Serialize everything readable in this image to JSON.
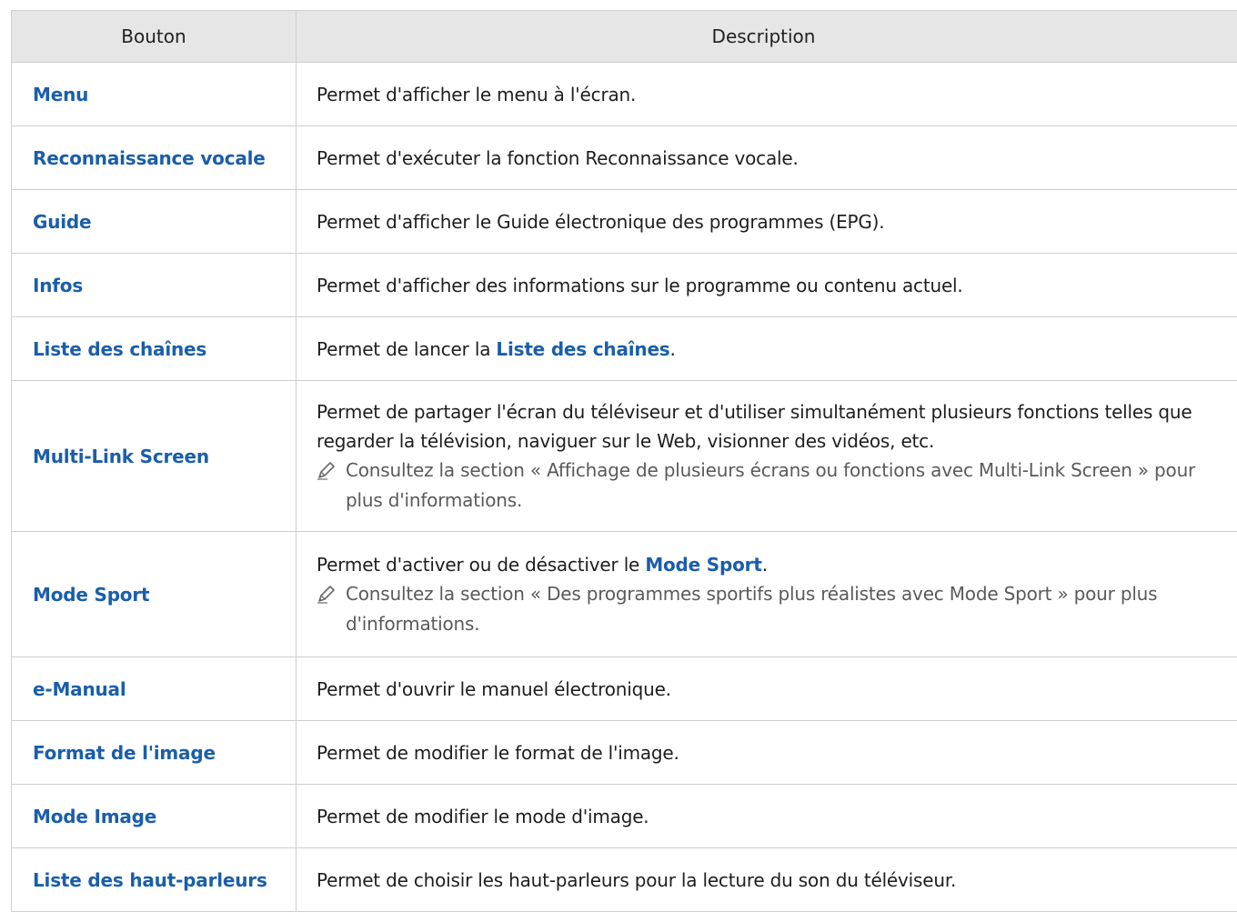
{
  "header": {
    "col1": "Bouton",
    "col2": "Description"
  },
  "rows": [
    {
      "button": "Menu",
      "desc": "Permet d'afficher le menu à l'écran."
    },
    {
      "button": "Reconnaissance vocale",
      "desc": "Permet d'exécuter la fonction Reconnaissance vocale."
    },
    {
      "button": "Guide",
      "desc": "Permet d'afficher le Guide électronique des programmes (EPG)."
    },
    {
      "button": "Infos",
      "desc": "Permet d'afficher des informations sur le programme ou contenu actuel."
    },
    {
      "button": "Liste des chaînes",
      "desc_pre": "Permet de lancer la ",
      "desc_link": "Liste des chaînes",
      "desc_post": "."
    },
    {
      "button": "Multi-Link Screen",
      "desc": "Permet de partager l'écran du téléviseur et d'utiliser simultanément plusieurs fonctions telles que regarder la télévision, naviguer sur le Web, visionner des vidéos, etc.",
      "note": "Consultez la section « Affichage de plusieurs écrans ou fonctions avec Multi-Link Screen » pour plus d'informations."
    },
    {
      "button": "Mode Sport",
      "desc_pre": "Permet d'activer ou de désactiver le ",
      "desc_link": "Mode Sport",
      "desc_post": ".",
      "note": "Consultez la section « Des programmes sportifs plus réalistes avec Mode Sport » pour plus d'informations."
    },
    {
      "button": "e-Manual",
      "desc": "Permet d'ouvrir le manuel électronique."
    },
    {
      "button": "Format de l'image",
      "desc": "Permet de modifier le format de l'image."
    },
    {
      "button": "Mode Image",
      "desc": "Permet de modifier le mode d'image."
    },
    {
      "button": "Liste des haut-parleurs",
      "desc": "Permet de choisir les haut-parleurs pour la lecture du son du téléviseur."
    }
  ],
  "colors": {
    "link": "#1a5eab",
    "header_bg": "#e6e6e6",
    "border": "#cfcfcf",
    "note_text": "#5a5a5a"
  },
  "icons": {
    "note": "pencil-icon"
  }
}
